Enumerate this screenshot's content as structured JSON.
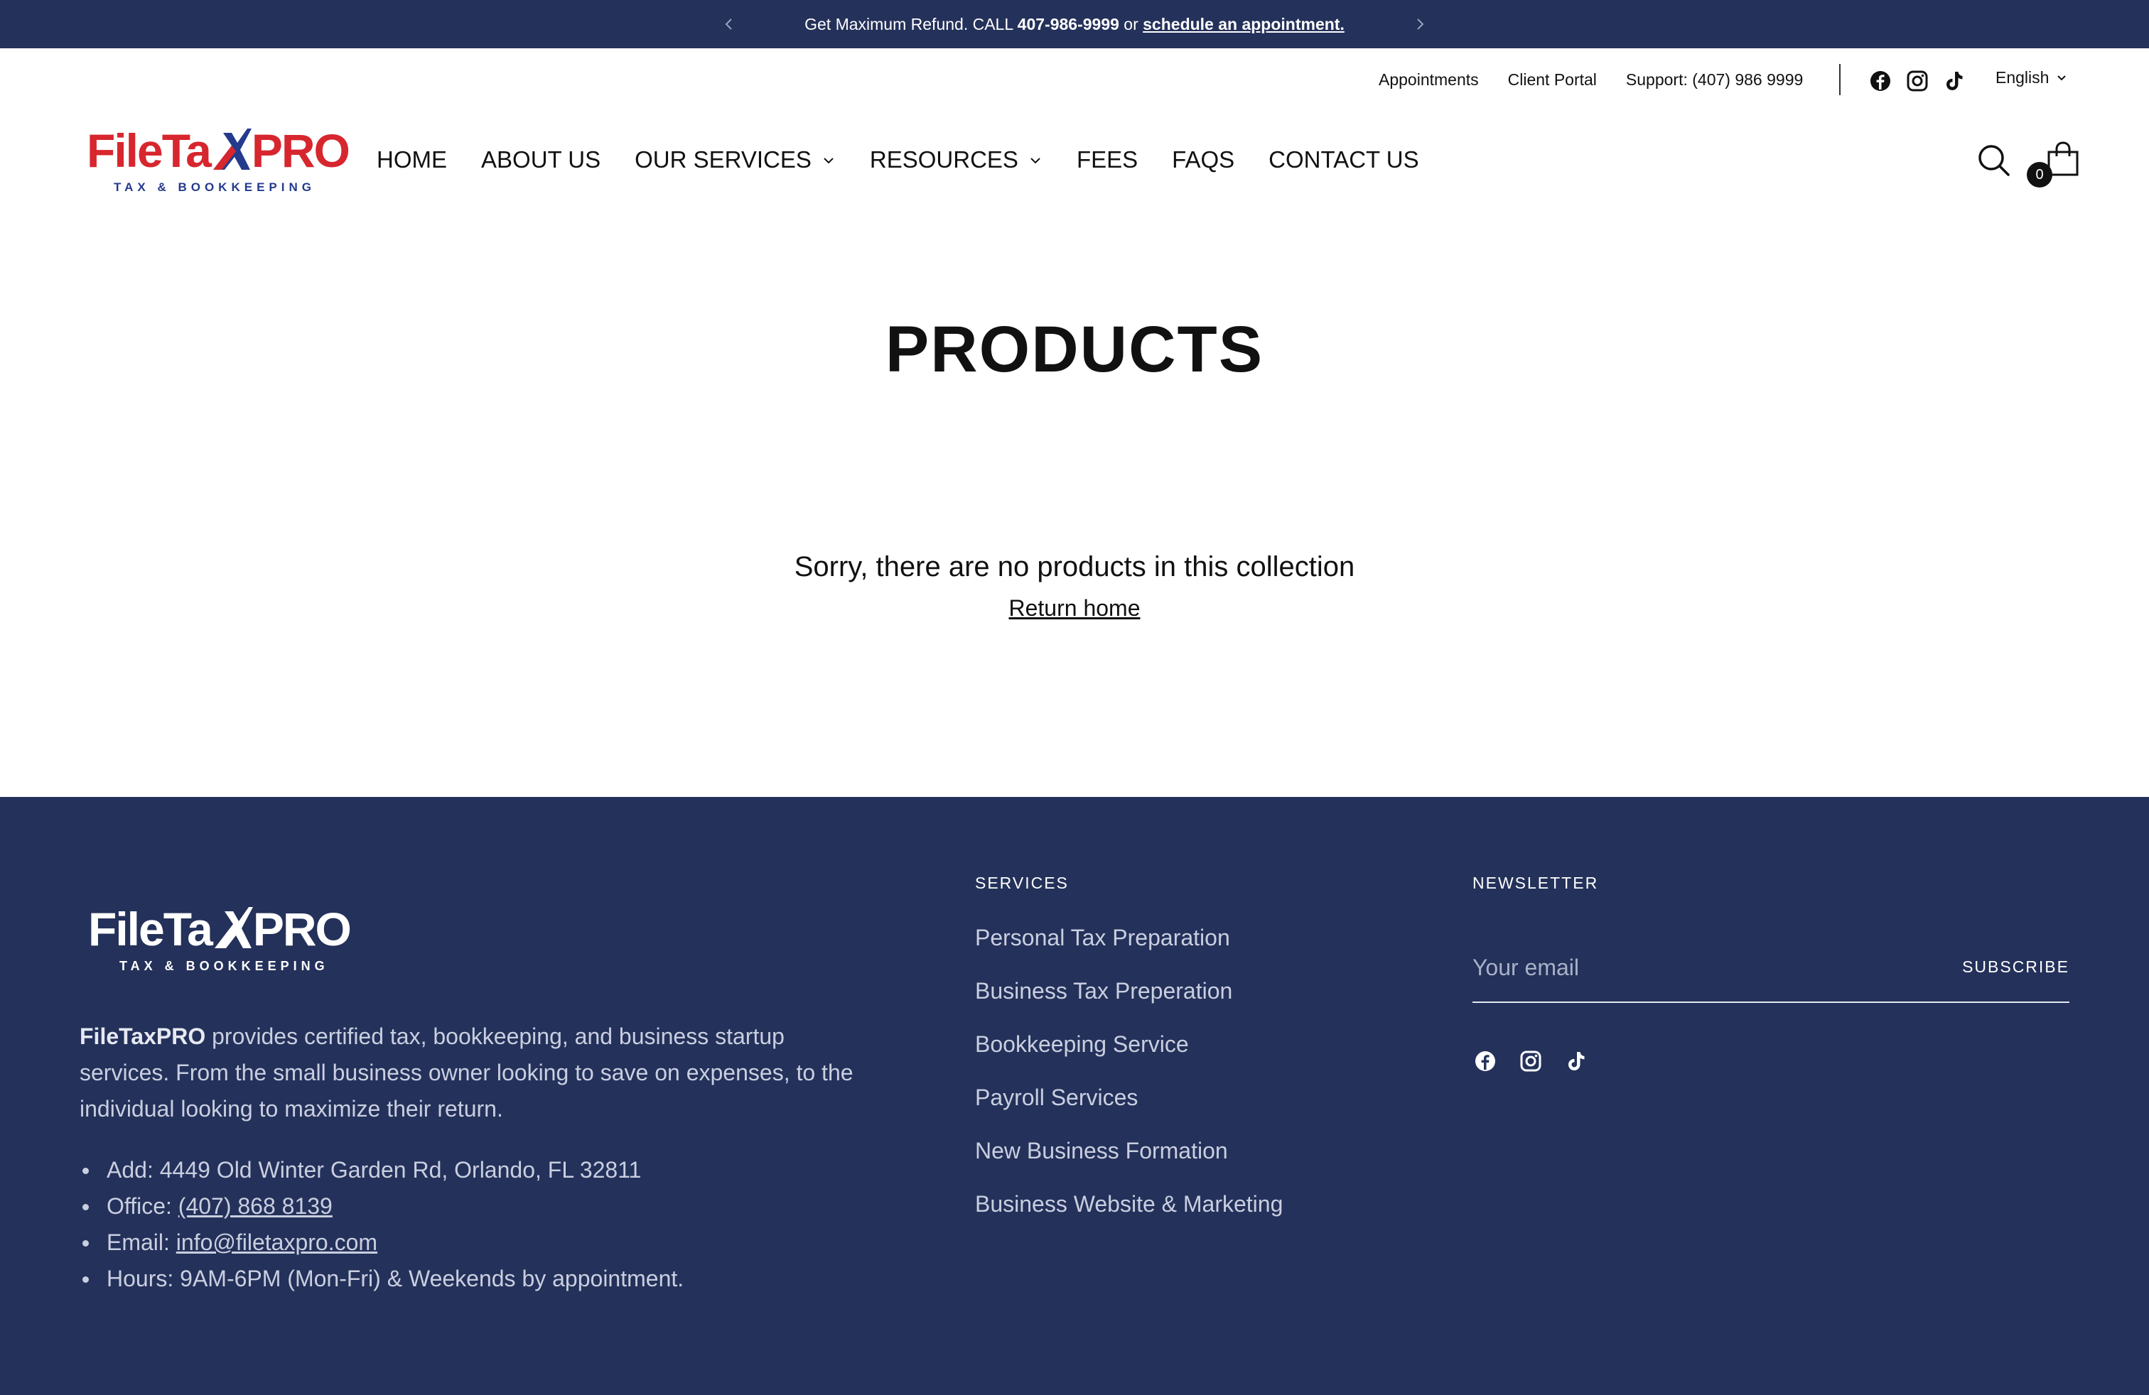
{
  "announcement": {
    "prefix": "Get Maximum Refund. CALL ",
    "phone": "407-986-9999",
    "middle": " or ",
    "link": "schedule an appointment."
  },
  "utility": {
    "appointments": "Appointments",
    "client_portal": "Client Portal",
    "support": "Support: (407) 986 9999",
    "language": "English"
  },
  "logo": {
    "word_a": "FileTa",
    "word_b": "PRO",
    "tagline": "TAX & BOOKKEEPING"
  },
  "nav": {
    "home": "HOME",
    "about": "ABOUT US",
    "services": "OUR SERVICES",
    "resources": "RESOURCES",
    "fees": "FEES",
    "faqs": "FAQS",
    "contact": "CONTACT US"
  },
  "cart": {
    "count": "0"
  },
  "main": {
    "title": "PRODUCTS",
    "empty_message": "Sorry, there are no products in this collection",
    "return_link": "Return home"
  },
  "footer": {
    "about_brand": "FileTaxPRO",
    "about_text": " provides certified tax, bookkeeping, and business startup services. From the small business owner looking to save on expenses, to the individual looking to maximize their return.",
    "address": "Add: 4449 Old Winter Garden Rd, Orlando, FL 32811",
    "office_label": "Office: ",
    "office_phone": "(407) 868 8139",
    "email_label": "Email: ",
    "email": "info@filetaxpro.com",
    "hours": "Hours: 9AM-6PM (Mon-Fri) & Weekends by appointment.",
    "services_heading": "SERVICES",
    "services": [
      "Personal Tax Preparation",
      "Business Tax Preperation",
      "Bookkeeping Service",
      "Payroll Services",
      "New Business Formation",
      "Business Website & Marketing"
    ],
    "newsletter_heading": "NEWSLETTER",
    "email_placeholder": "Your email",
    "subscribe": "SUBSCRIBE"
  },
  "colors": {
    "navy": "#24315a",
    "brand_red": "#d7262e",
    "brand_blue": "#243a8c"
  },
  "icons": [
    "chevron-left-icon",
    "chevron-right-icon",
    "facebook-icon",
    "instagram-icon",
    "tiktok-icon",
    "chevron-down-icon",
    "search-icon",
    "shopping-bag-icon"
  ]
}
